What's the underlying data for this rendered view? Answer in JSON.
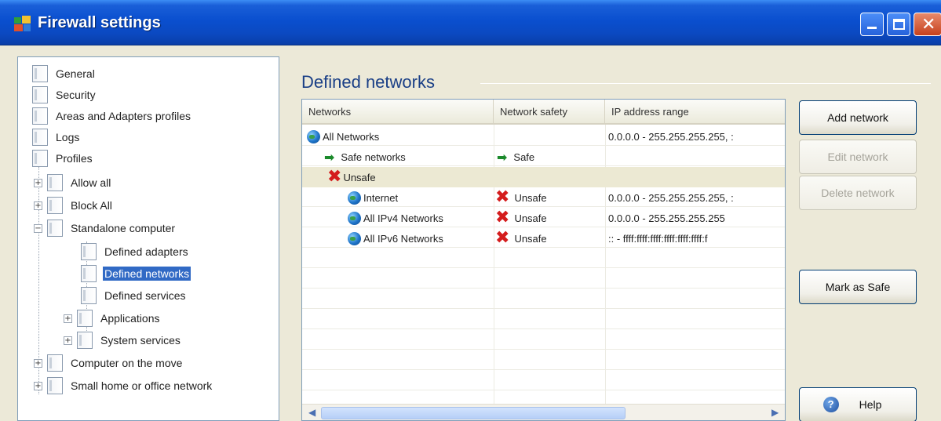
{
  "window": {
    "title": "Firewall settings"
  },
  "tree": {
    "items": [
      {
        "label": "General"
      },
      {
        "label": "Security"
      },
      {
        "label": "Areas and Adapters profiles"
      },
      {
        "label": "Logs"
      },
      {
        "label": "Profiles"
      },
      {
        "label": "Allow all",
        "expander": "+"
      },
      {
        "label": "Block All",
        "expander": "+"
      },
      {
        "label": "Standalone computer",
        "expander": "−"
      },
      {
        "label": "Defined adapters"
      },
      {
        "label": "Defined networks",
        "selected": true
      },
      {
        "label": "Defined services"
      },
      {
        "label": "Applications",
        "expander": "+"
      },
      {
        "label": "System services",
        "expander": "+"
      },
      {
        "label": "Computer on the move",
        "expander": "+"
      },
      {
        "label": "Small home or office network",
        "expander": "+"
      }
    ]
  },
  "main": {
    "heading": "Defined networks",
    "columns": [
      "Networks",
      "Network safety",
      "IP address range"
    ],
    "rows": [
      {
        "name": "All Networks",
        "icon": "globe-icon",
        "safety": "",
        "safety_icon": "",
        "range": "0.0.0.0 - 255.255.255.255, :"
      },
      {
        "name": "Safe networks",
        "icon": "green-arrow-icon",
        "safety": "Safe",
        "safety_icon": "green-arrow-icon",
        "range": ""
      },
      {
        "name": "Unsafe",
        "icon": "red-x-icon",
        "safety": "",
        "safety_icon": "",
        "range": ""
      },
      {
        "name": "Internet",
        "icon": "globe-icon",
        "safety": "Unsafe",
        "safety_icon": "red-x-icon",
        "range": "0.0.0.0 - 255.255.255.255, :"
      },
      {
        "name": "All IPv4 Networks",
        "icon": "globe-icon",
        "safety": "Unsafe",
        "safety_icon": "red-x-icon",
        "range": "0.0.0.0 - 255.255.255.255"
      },
      {
        "name": "All IPv6 Networks",
        "icon": "globe-icon",
        "safety": "Unsafe",
        "safety_icon": "red-x-icon",
        "range": ":: - ffff:ffff:ffff:ffff:ffff:ffff:f"
      }
    ]
  },
  "buttons": {
    "add": "Add network",
    "edit": "Edit network",
    "delete": "Delete network",
    "mark_safe": "Mark as Safe",
    "help": "Help"
  },
  "colors": {
    "titlebar": "#0a4fcf",
    "selection": "#316ac5",
    "heading": "#1a3f86",
    "unsafe": "#d41c1c",
    "safe": "#1b8a2b"
  }
}
